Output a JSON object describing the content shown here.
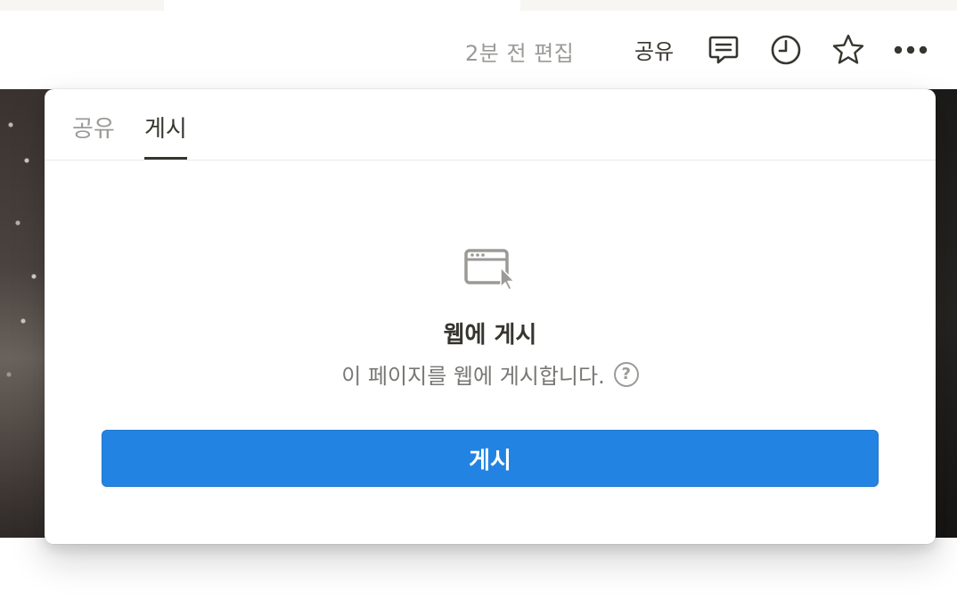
{
  "topbar": {
    "edited_label": "2분 전 편집",
    "share_label": "공유",
    "icons": [
      "comment-icon",
      "clock-icon",
      "star-icon",
      "more-icon"
    ]
  },
  "popup": {
    "tabs": [
      {
        "label": "공유",
        "active": false
      },
      {
        "label": "게시",
        "active": true
      }
    ],
    "icon": "browser-window-cursor-icon",
    "title": "웹에 게시",
    "description": "이 페이지를 웹에 게시합니다.",
    "help_glyph": "?",
    "publish_button_label": "게시"
  },
  "colors": {
    "accent": "#2383e2",
    "text_primary": "#37352f",
    "text_secondary": "#787774",
    "text_muted": "#9b9a97"
  }
}
